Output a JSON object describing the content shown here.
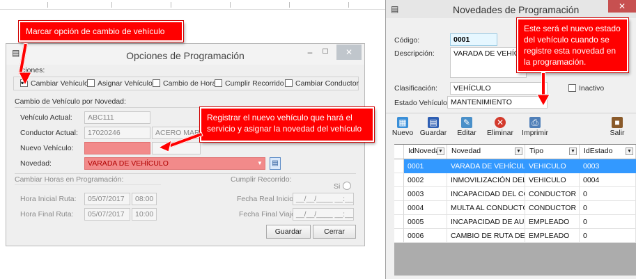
{
  "left_dialog": {
    "title": "Opciones de Programación",
    "min": "–",
    "max": "☐",
    "close": "✕",
    "options_label": "ciones:",
    "options": [
      {
        "label": "Cambiar Vehículo",
        "checked": true
      },
      {
        "label": "Asignar Vehículo",
        "checked": false
      },
      {
        "label": "Cambio de Horas",
        "checked": false
      },
      {
        "label": "Cumplir Recorrido",
        "checked": false
      },
      {
        "label": "Cambiar Conductor",
        "checked": false
      }
    ],
    "section_vehicle": "Cambio de Vehículo por Novedad:",
    "vehiculo_actual_label": "Vehículo Actual:",
    "vehiculo_actual_value": "ABC111",
    "conductor_actual_label": "Conductor Actual:",
    "conductor_actual_value": "17020246",
    "conductor_actual_name": "ACERO MARTINE",
    "nuevo_vehiculo_label": "Nuevo Vehículo:",
    "nuevo_vehiculo_value": "",
    "novedad_label": "Novedad:",
    "novedad_value": "VARADA DE VEHÍCULO",
    "section_hours": "Cambiar Horas en Programación:",
    "hora_inicial_label": "Hora Inicial Ruta:",
    "hora_inicial_date": "05/07/2017",
    "hora_inicial_time": "08:00",
    "hora_final_label": "Hora Final Ruta:",
    "hora_final_date": "05/07/2017",
    "hora_final_time": "10:00",
    "section_cumplir": "Cumplir Recorrido:",
    "si_label": "Si",
    "fecha_real_inicio_label": "Fecha Real Inicio:",
    "fecha_real_inicio_value": "__/__/____ __:__",
    "fecha_final_viaje_label": "Fecha Final Viaje:",
    "fecha_final_viaje_value": "__/__/____ __:__",
    "guardar": "Guardar",
    "cerrar": "Cerrar"
  },
  "callouts": {
    "marcar": "Marcar opción de cambio de vehículo",
    "registrar": "Registrar el nuevo vehículo que hará el servicio y asignar la novedad del vehículo",
    "nuevo_estado": "Este será el nuevo estado del vehículo cuando se registre esta novedad en la programación."
  },
  "right_window": {
    "title": "Novedades de Programación",
    "close": "✕",
    "codigo_label": "Código:",
    "codigo_value": "0001",
    "descripcion_label": "Descripción:",
    "descripcion_value": "VARADA DE VEHÍCUL",
    "clasificacion_label": "Clasificación:",
    "clasificacion_value": "VEHÍCULO",
    "inactivo_label": "Inactivo",
    "estado_vehiculo_label": "Estado Vehículo:",
    "estado_vehiculo_value": "MANTENIMIENTO",
    "toolbar": [
      {
        "label": "Nuevo",
        "icon": "new-icon",
        "color": "#3a8fd8"
      },
      {
        "label": "Guardar",
        "icon": "save-icon",
        "color": "#2f5fb3"
      },
      {
        "label": "Editar",
        "icon": "edit-icon",
        "color": "#4a90c9"
      },
      {
        "label": "Eliminar",
        "icon": "delete-icon",
        "color": "#d33a2c"
      },
      {
        "label": "Imprimir",
        "icon": "print-icon",
        "color": "#4f7fb8"
      },
      {
        "label": "Salir",
        "icon": "exit-icon",
        "color": "#8a5a2a"
      }
    ],
    "columns": [
      "IdNoveda",
      "Novedad",
      "Tipo",
      "IdEstado"
    ],
    "rows": [
      [
        "0001",
        "VARADA DE VEHÍCULO",
        "VEHICULO",
        "0003"
      ],
      [
        "0002",
        "INMOVILIZACIÓN DEL ...",
        "VEHICULO",
        "0004"
      ],
      [
        "0003",
        "INCAPACIDAD DEL CO...",
        "CONDUCTOR",
        "0"
      ],
      [
        "0004",
        "MULTA AL CONDUCTOR",
        "CONDUCTOR",
        "0"
      ],
      [
        "0005",
        "INCAPACIDAD DE AUXI...",
        "EMPLEADO",
        "0"
      ],
      [
        "0006",
        "CAMBIO DE RUTA DE A...",
        "EMPLEADO",
        "0"
      ]
    ],
    "selected_row": 0
  },
  "colors": {
    "callout": "#ff0000",
    "selection": "#3399ff",
    "invalid_field": "#f28a8a"
  }
}
